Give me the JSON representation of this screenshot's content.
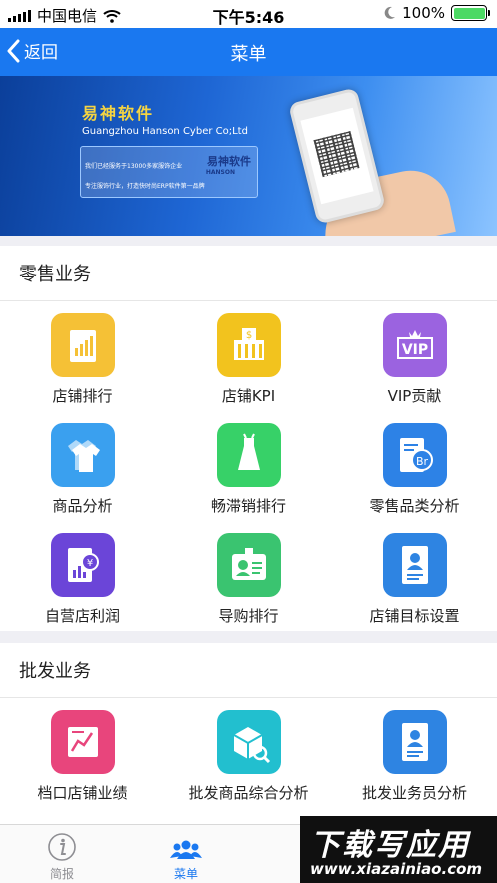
{
  "status_bar": {
    "carrier": "中国电信",
    "time": "下午5:46",
    "battery": "100%",
    "battery_level": 1.0
  },
  "nav": {
    "back_label": "返回",
    "title": "菜单"
  },
  "banner": {
    "brand": "易神软件",
    "company": "Guangzhou Hanson Cyber Co;Ltd",
    "line1": "我们已经服务于13000多家服饰企业",
    "line2": "专注服饰行业，打造快时尚ERP软件第一品牌",
    "logo": "易神软件",
    "logo_sub": "HANSON"
  },
  "retail": {
    "title": "零售业务",
    "items": [
      {
        "label": "店铺排行",
        "icon": "store-ranking-icon",
        "color": "#f5c136"
      },
      {
        "label": "店铺KPI",
        "icon": "store-kpi-icon",
        "color": "#f2c31e"
      },
      {
        "label": "VIP贡献",
        "icon": "vip-contribution-icon",
        "color": "#9b63e0"
      },
      {
        "label": "商品分析",
        "icon": "product-analysis-icon",
        "color": "#3aa0ef"
      },
      {
        "label": "畅滞销排行",
        "icon": "sales-ranking-icon",
        "color": "#37d168"
      },
      {
        "label": "零售品类分析",
        "icon": "retail-category-icon",
        "color": "#2d82e6"
      },
      {
        "label": "自营店利润",
        "icon": "store-profit-icon",
        "color": "#6b45d8"
      },
      {
        "label": "导购排行",
        "icon": "guide-ranking-icon",
        "color": "#3ac470"
      },
      {
        "label": "店铺目标设置",
        "icon": "store-target-icon",
        "color": "#2e84e2"
      }
    ]
  },
  "wholesale": {
    "title": "批发业务",
    "items": [
      {
        "label": "档口店铺业绩",
        "icon": "stall-performance-icon",
        "color": "#e8457c"
      },
      {
        "label": "批发商品综合分析",
        "icon": "wholesale-product-icon",
        "color": "#22bfcf"
      },
      {
        "label": "批发业务员分析",
        "icon": "wholesale-salesman-icon",
        "color": "#2e84e2"
      }
    ]
  },
  "tabbar": {
    "tabs": [
      {
        "label": "简报"
      },
      {
        "label": "菜单"
      }
    ],
    "active_color": "#1a78f0",
    "inactive_color": "#8e8e93"
  },
  "watermark": {
    "line1": "下载写应用",
    "line2": "www.xiazainiao.com"
  }
}
